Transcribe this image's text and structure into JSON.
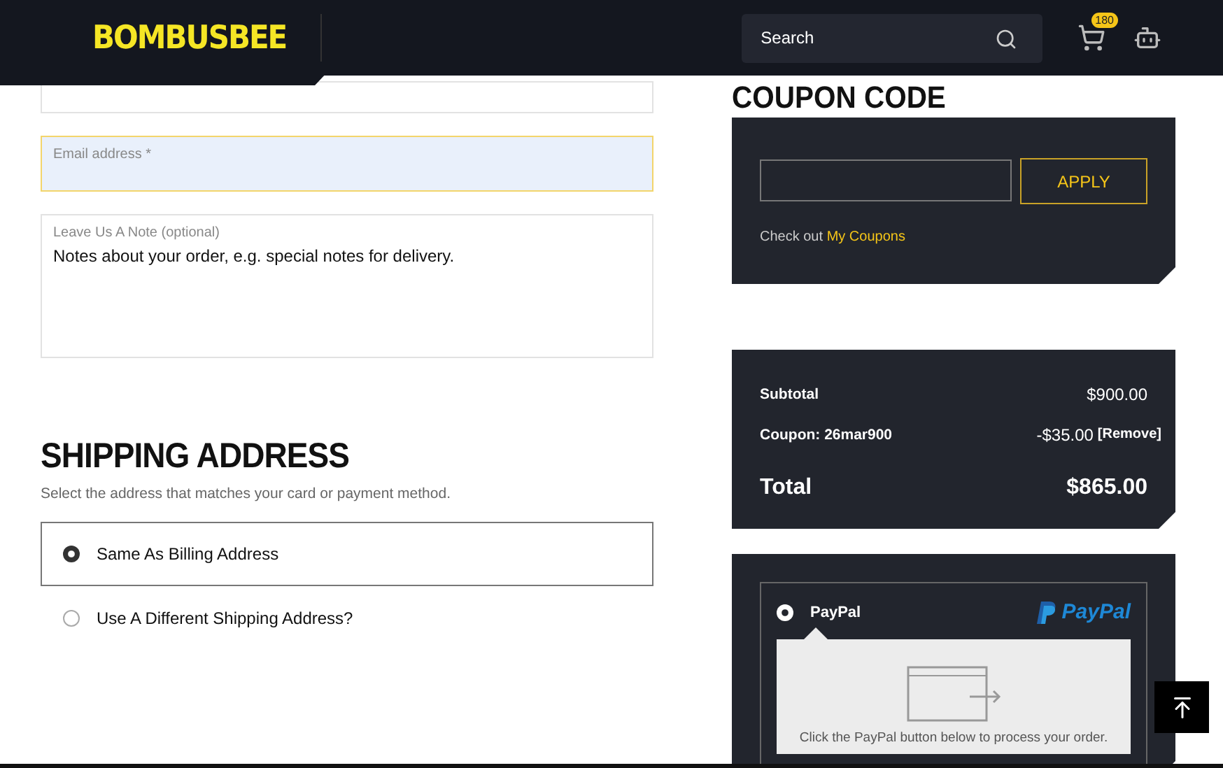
{
  "header": {
    "logo": "BOMBUSBEE",
    "search": {
      "placeholder": "Search"
    },
    "cart_count": "180"
  },
  "billing": {
    "fields": [
      {
        "kind": "input",
        "focused": false
      },
      {
        "kind": "input",
        "label": "Email address *",
        "focused": true
      },
      {
        "kind": "textarea",
        "label": "Leave Us A Note (optional)",
        "placeholder": "Notes about your order, e.g. special notes for delivery.",
        "focused": false
      }
    ]
  },
  "shipping": {
    "title": "SHIPPING ADDRESS",
    "subtitle": "Select the address that matches your card or payment method.",
    "options": [
      {
        "label": "Same As Billing Address",
        "selected": true
      },
      {
        "label": "Use A Different Shipping Address?",
        "selected": false
      }
    ]
  },
  "coupon": {
    "title": "COUPON CODE",
    "button": "APPLY",
    "note": "Check out",
    "link": "My Coupons"
  },
  "totals": {
    "rows": [
      {
        "kind": "line",
        "label": "Subtotal",
        "value": "$900.00"
      },
      {
        "kind": "coupon",
        "label": "Coupon: 26mar900",
        "value": "-$35.00",
        "action": "[Remove]"
      },
      {
        "kind": "total",
        "label": "Total",
        "value": "$865.00"
      }
    ]
  },
  "payment": {
    "methods": [
      {
        "label": "PayPal",
        "logo_text": "PayPal",
        "selected": true,
        "description": "Click the PayPal button below to process your order."
      }
    ]
  }
}
